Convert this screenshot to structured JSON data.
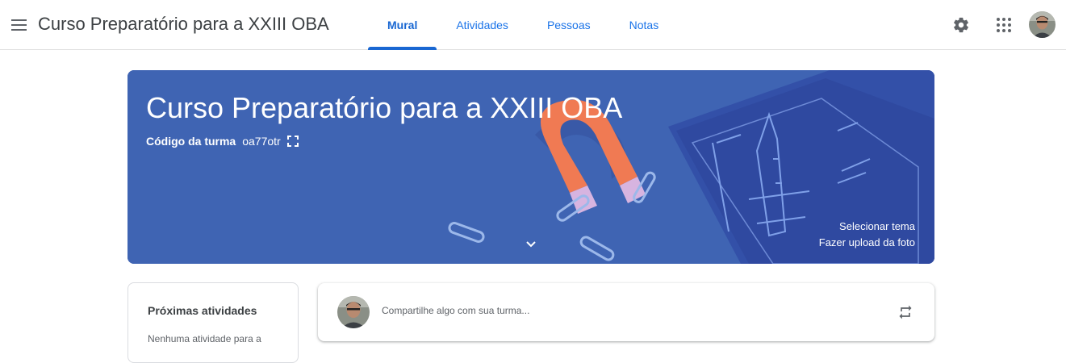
{
  "header": {
    "menu_icon": "hamburger-menu-icon",
    "class_title": "Curso Preparatório para a XXIII OBA",
    "tabs": [
      {
        "label": "Mural",
        "active": true
      },
      {
        "label": "Atividades",
        "active": false
      },
      {
        "label": "Pessoas",
        "active": false
      },
      {
        "label": "Notas",
        "active": false
      }
    ],
    "settings_icon": "gear-icon",
    "apps_icon": "apps-grid-icon",
    "account_avatar": "user-avatar"
  },
  "banner": {
    "title": "Curso Preparatório para a XXIII OBA",
    "class_code_label": "Código da turma",
    "class_code_value": "oa77otr",
    "expand_icon": "fullscreen-icon",
    "chevron_icon": "chevron-down-icon",
    "select_theme": "Selecionar tema",
    "upload_photo": "Fazer upload da foto",
    "background_color": "#3f64b3"
  },
  "upcoming": {
    "title": "Próximas atividades",
    "empty_text": "Nenhuma atividade para a"
  },
  "share": {
    "placeholder": "Compartilhe algo com sua turma...",
    "repost_icon": "repost-icon"
  },
  "colors": {
    "accent": "#1967d2",
    "tab_text": "#1a73e8",
    "banner": "#3f64b3"
  }
}
